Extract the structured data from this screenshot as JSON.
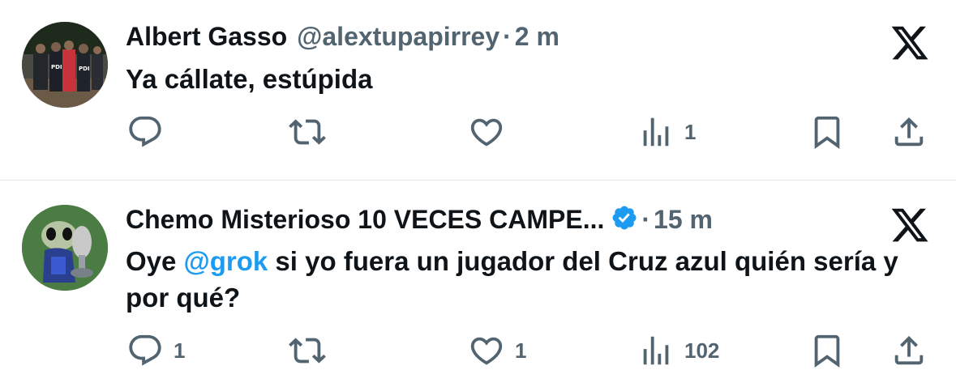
{
  "tweets": [
    {
      "author_name": "Albert Gasso",
      "handle": "@alextupapirrey",
      "separator": "·",
      "time": "2 m",
      "text": "Ya cállate, estúpida",
      "avatar": "police-photo-avatar",
      "actions": {
        "reply_count": "",
        "retweet_count": "",
        "like_count": "",
        "views_count": "1"
      }
    },
    {
      "author_name": "Chemo Misterioso 10 VECES CAMPE...",
      "verified": true,
      "separator": "·",
      "time": "15 m",
      "text_before": "Oye ",
      "mention": "@grok",
      "text_after": " si yo fuera un jugador del Cruz azul quién sería y por qué?",
      "avatar": "alien-trophy-avatar",
      "actions": {
        "reply_count": "1",
        "retweet_count": "",
        "like_count": "1",
        "views_count": "102"
      }
    }
  ],
  "colors": {
    "text": "#0f1419",
    "secondary": "#536471",
    "accent": "#1d9bf0",
    "divider": "#e1e4e8"
  },
  "icons": [
    "reply-icon",
    "retweet-icon",
    "like-icon",
    "views-icon",
    "bookmark-icon",
    "share-icon",
    "x-logo-icon",
    "verified-badge-icon"
  ]
}
